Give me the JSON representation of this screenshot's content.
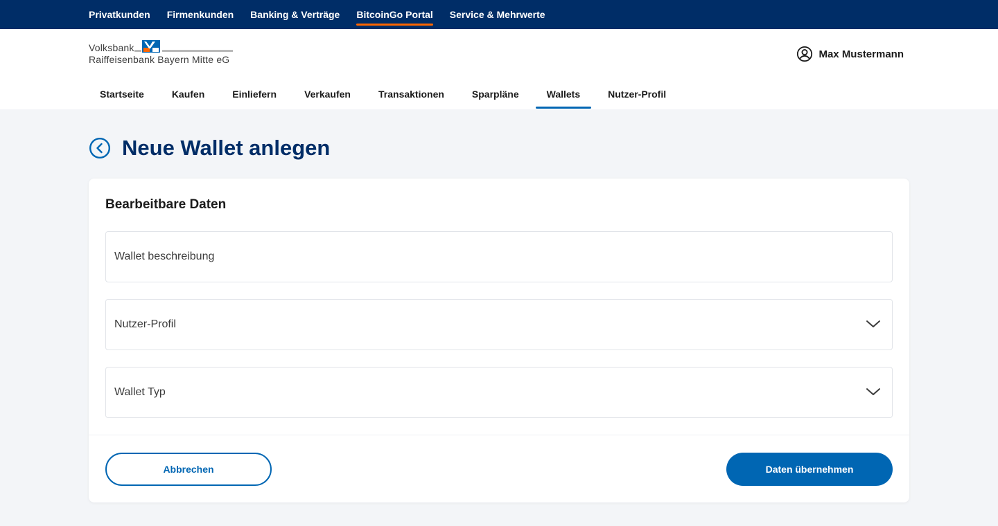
{
  "topnav": {
    "items": [
      {
        "label": "Privatkunden"
      },
      {
        "label": "Firmenkunden"
      },
      {
        "label": "Banking & Verträge"
      },
      {
        "label": "BitcoinGo Portal"
      },
      {
        "label": "Service & Mehrwerte"
      }
    ],
    "active_index": 3
  },
  "logo": {
    "line1": "Volksbank",
    "line2": "Raiffeisenbank Bayern Mitte eG"
  },
  "user": {
    "name": "Max Mustermann"
  },
  "subnav": {
    "items": [
      {
        "label": "Startseite"
      },
      {
        "label": "Kaufen"
      },
      {
        "label": "Einliefern"
      },
      {
        "label": "Verkaufen"
      },
      {
        "label": "Transaktionen"
      },
      {
        "label": "Sparpläne"
      },
      {
        "label": "Wallets"
      },
      {
        "label": "Nutzer-Profil"
      }
    ],
    "active_index": 6
  },
  "page": {
    "title": "Neue Wallet anlegen"
  },
  "form": {
    "section_title": "Bearbeitbare Daten",
    "description": {
      "value": "",
      "placeholder": "Wallet beschreibung"
    },
    "profile_select": {
      "label": "Nutzer-Profil"
    },
    "type_select": {
      "label": "Wallet Typ"
    },
    "cancel_label": "Abbrechen",
    "submit_label": "Daten übernehmen"
  },
  "colors": {
    "brand_dark": "#002d67",
    "brand_primary": "#0066b3",
    "accent_orange": "#ff6600",
    "page_bg": "#f3f5f8"
  }
}
